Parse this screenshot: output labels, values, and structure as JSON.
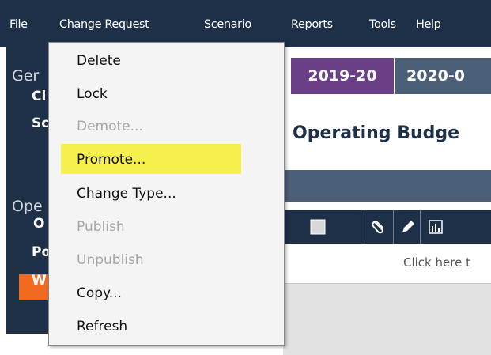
{
  "menubar": {
    "items": [
      "File",
      "Change Request",
      "Scenario",
      "Reports",
      "Tools",
      "Help"
    ]
  },
  "sidebar": {
    "section1": "Ger",
    "section1_items": [
      "Cl",
      "Sc"
    ],
    "section2": "Ope",
    "section2_items": [
      "O",
      "Po",
      "W"
    ]
  },
  "main": {
    "year_tabs": [
      "2019-20",
      "2020-0"
    ],
    "title": "Operating Budge",
    "click_here": "Click here t"
  },
  "dropdown": {
    "items": [
      {
        "label": "Delete",
        "enabled": true
      },
      {
        "label": "Lock",
        "enabled": true
      },
      {
        "label": "Demote...",
        "enabled": false
      },
      {
        "label": "Promote...",
        "enabled": true,
        "highlighted": true
      },
      {
        "label": "Change Type...",
        "enabled": true
      },
      {
        "label": "Publish",
        "enabled": false
      },
      {
        "label": "Unpublish",
        "enabled": false
      },
      {
        "label": "Copy...",
        "enabled": true
      },
      {
        "label": "Refresh",
        "enabled": true
      }
    ]
  },
  "colors": {
    "navy": "#1e2f48",
    "active_year_tab": "#6b3f86",
    "highlight": "#f5f04d",
    "active_nav": "#f26a21",
    "disabled_text": "#a6a6a6"
  },
  "icons": [
    "checkbox-icon",
    "paperclip-icon",
    "pencil-icon",
    "bar-chart-icon"
  ]
}
